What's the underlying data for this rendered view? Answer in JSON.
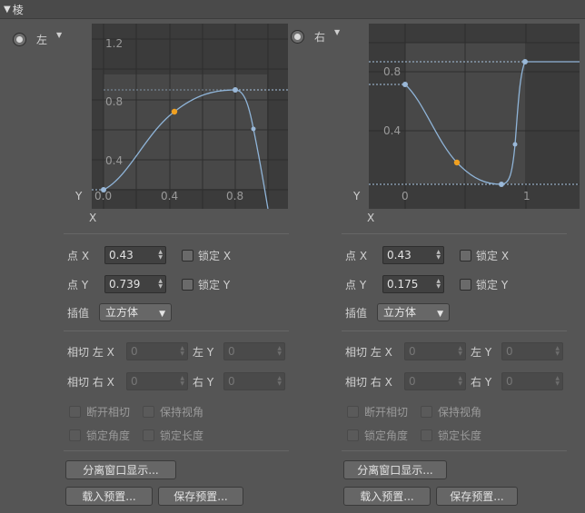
{
  "section": {
    "title": "棱"
  },
  "left": {
    "title": "左",
    "y_ticks": [
      "1.2",
      "0.8",
      "0.4"
    ],
    "x_ticks": [
      "0.0",
      "0.4",
      "0.8"
    ],
    "axis_y": "Y",
    "axis_x": "X",
    "point_x_label": "点 X",
    "point_x_value": "0.43",
    "lock_x_label": "锁定 X",
    "point_y_label": "点 Y",
    "point_y_value": "0.739",
    "lock_y_label": "锁定 Y",
    "interp_label": "插值",
    "interp_value": "立方体",
    "tangent_left_x_label": "相切 左 X",
    "tangent_left_x_value": "0",
    "left_y_label": "左 Y",
    "left_y_value": "0",
    "tangent_right_x_label": "相切 右 X",
    "tangent_right_x_value": "0",
    "right_y_label": "右 Y",
    "right_y_value": "0",
    "break_tangent_label": "断开相切",
    "keep_view_label": "保持视角",
    "lock_angle_label": "锁定角度",
    "lock_length_label": "锁定长度",
    "detach_button": "分离窗口显示...",
    "load_preset_button": "载入预置...",
    "save_preset_button": "保存预置..."
  },
  "right": {
    "title": "右",
    "y_ticks": [
      "0.8",
      "0.4"
    ],
    "x_ticks": [
      "0",
      "1"
    ],
    "axis_y": "Y",
    "axis_x": "X",
    "point_x_label": "点 X",
    "point_x_value": "0.43",
    "lock_x_label": "锁定 X",
    "point_y_label": "点 Y",
    "point_y_value": "0.175",
    "lock_y_label": "锁定 Y",
    "interp_label": "插值",
    "interp_value": "立方体",
    "tangent_left_x_label": "相切 左 X",
    "tangent_left_x_value": "0",
    "left_y_label": "左 Y",
    "left_y_value": "0",
    "tangent_right_x_label": "相切 右 X",
    "tangent_right_x_value": "0",
    "right_y_label": "右 Y",
    "right_y_value": "0",
    "break_tangent_label": "断开相切",
    "keep_view_label": "保持视角",
    "lock_angle_label": "锁定角度",
    "lock_length_label": "锁定长度",
    "detach_button": "分离窗口显示...",
    "load_preset_button": "载入预置...",
    "save_preset_button": "保存预置..."
  },
  "colors": {
    "curve": "#8fb4d8",
    "selected_point": "#f0a020",
    "point": "#9ab8d8",
    "guide": "#a8c4e0"
  }
}
